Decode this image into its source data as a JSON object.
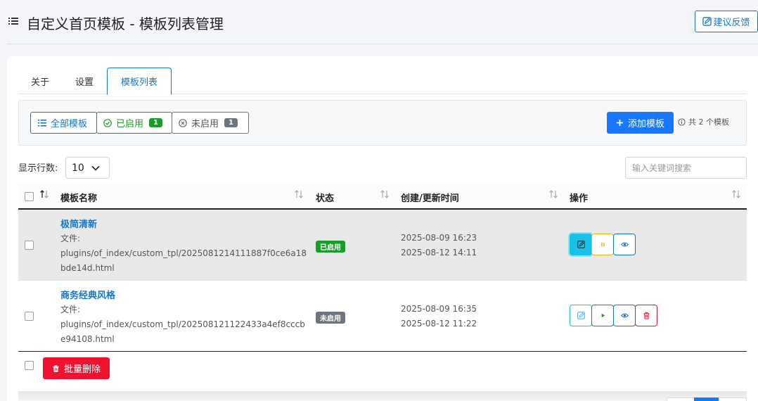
{
  "header": {
    "title": "自定义首页模板 - 模板列表管理",
    "feedback_label": "建议反馈"
  },
  "tabs": [
    {
      "label": "关于",
      "active": false
    },
    {
      "label": "设置",
      "active": false
    },
    {
      "label": "模板列表",
      "active": true
    }
  ],
  "filters": {
    "all_label": "全部模板",
    "enabled_label": "已启用",
    "enabled_count": "1",
    "disabled_label": "未启用",
    "disabled_count": "1",
    "add_label": "添加模板",
    "total_note": "共 2 个模板"
  },
  "table_controls": {
    "rows_label": "显示行数:",
    "rows_value": "10",
    "search_placeholder": "输入关键词搜索"
  },
  "columns": {
    "name": "模板名称",
    "status": "状态",
    "time": "创建/更新时间",
    "actions": "操作"
  },
  "rows": [
    {
      "name": "极简清新",
      "file_label": "文件:",
      "file_path": "plugins/of_index/custom_tpl/2025081214111887f0ce6a18bde14d.html",
      "status": "已启用",
      "created": "2025-08-09 16:23",
      "updated": "2025-08-12 14:11"
    },
    {
      "name": "商务经典风格",
      "file_label": "文件:",
      "file_path": "plugins/of_index/custom_tpl/202508121122433a4ef8cccbe94108.html",
      "status": "未启用",
      "created": "2025-08-09 16:35",
      "updated": "2025-08-12 11:22"
    }
  ],
  "footer": {
    "bulk_delete_label": "批量删除"
  },
  "colors": {
    "primary": "#1677ff",
    "link": "#1677c9",
    "success": "#1a9c2a",
    "secondary": "#6c757d",
    "danger": "#ef1330",
    "info": "#17c1e8",
    "warning": "#f5b400"
  },
  "icons": [
    "list-icon",
    "edit-square-icon",
    "check-circle-icon",
    "x-circle-icon",
    "plus-icon",
    "info-icon",
    "chevron-down-icon",
    "sort-icon",
    "edit-icon",
    "pause-icon",
    "play-icon",
    "eye-icon",
    "trash-icon"
  ]
}
